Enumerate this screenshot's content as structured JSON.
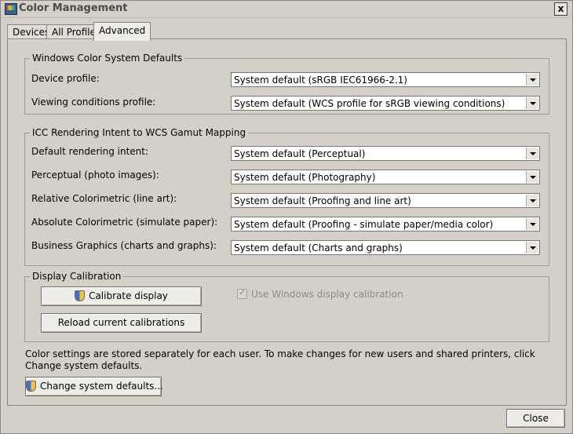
{
  "window": {
    "title": "Color Management",
    "close_glyph": "x"
  },
  "tabs": [
    {
      "label": "Devices"
    },
    {
      "label": "All Profiles"
    },
    {
      "label": "Advanced",
      "active": true
    }
  ],
  "wcs_defaults": {
    "title": "Windows Color System Defaults",
    "rows": [
      {
        "label": "Device profile:",
        "value": "System default (sRGB IEC61966-2.1)"
      },
      {
        "label": "Viewing conditions profile:",
        "value": "System default (WCS profile for sRGB viewing conditions)"
      }
    ]
  },
  "icc_mapping": {
    "title": "ICC Rendering Intent to WCS Gamut Mapping",
    "rows": [
      {
        "label": "Default rendering intent:",
        "value": "System default (Perceptual)"
      },
      {
        "label": "Perceptual (photo images):",
        "value": "System default (Photography)"
      },
      {
        "label": "Relative Colorimetric (line art):",
        "value": "System default (Proofing and line art)"
      },
      {
        "label": "Absolute Colorimetric (simulate paper):",
        "value": "System default (Proofing - simulate paper/media color)"
      },
      {
        "label": "Business Graphics (charts and graphs):",
        "value": "System default (Charts and graphs)"
      }
    ]
  },
  "display_calibration": {
    "title": "Display Calibration",
    "calibrate_button": "Calibrate display",
    "reload_button": "Reload current calibrations",
    "use_windows_calibration_label": "Use Windows display calibration",
    "use_windows_calibration_checked": true,
    "use_windows_calibration_enabled": false
  },
  "footer": {
    "note": "Color settings are stored separately for each user. To make changes for new users and shared printers, click Change system defaults.",
    "change_defaults_button": "Change system defaults...",
    "close_button": "Close"
  }
}
